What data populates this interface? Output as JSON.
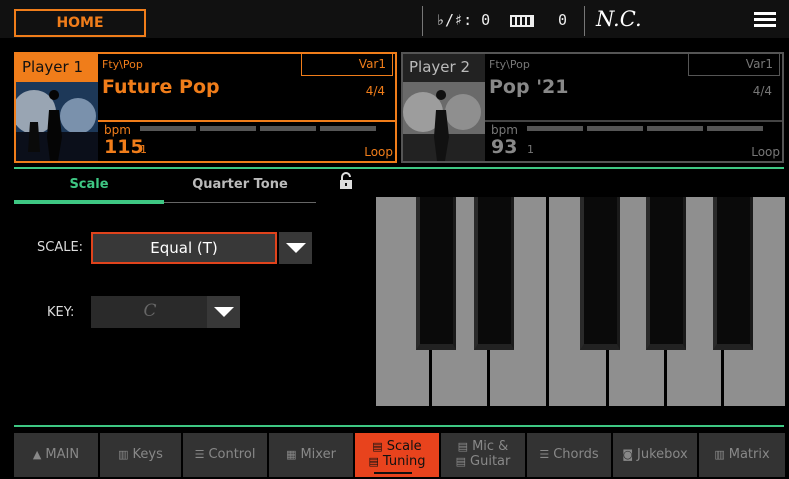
{
  "topbar": {
    "home_label": "HOME",
    "transpose": "♭/♯: 0",
    "octave": "0",
    "chord": "N.C."
  },
  "player1": {
    "label": "Player 1",
    "category": "Fty\\Pop",
    "variation": "Var1",
    "song": "Future Pop",
    "meter": "4/4",
    "bpm_label": "bpm",
    "bpm": "115",
    "beat": "1",
    "loop": "Loop"
  },
  "player2": {
    "label": "Player 2",
    "category": "Fty\\Pop",
    "variation": "Var1",
    "song": "Pop '21",
    "meter": "4/4",
    "bpm_label": "bpm",
    "bpm": "93",
    "beat": "1",
    "loop": "Loop"
  },
  "tabs": {
    "scale": "Scale",
    "quarter_tone": "Quarter Tone"
  },
  "form": {
    "scale_label": "SCALE:",
    "scale_value": "Equal (T)",
    "key_label": "KEY:",
    "key_value": "C"
  },
  "nav": {
    "main": "MAIN",
    "keys": "Keys",
    "control": "Control",
    "mixer": "Mixer",
    "scale_line1": "Scale",
    "scale_line2": "Tuning",
    "mic_line1": "Mic &",
    "mic_line2": "Guitar",
    "chords": "Chords",
    "jukebox": "Jukebox",
    "matrix": "Matrix"
  },
  "colors": {
    "accent": "#f07d1a",
    "green": "#3ec783",
    "active_nav": "#e8431d"
  }
}
